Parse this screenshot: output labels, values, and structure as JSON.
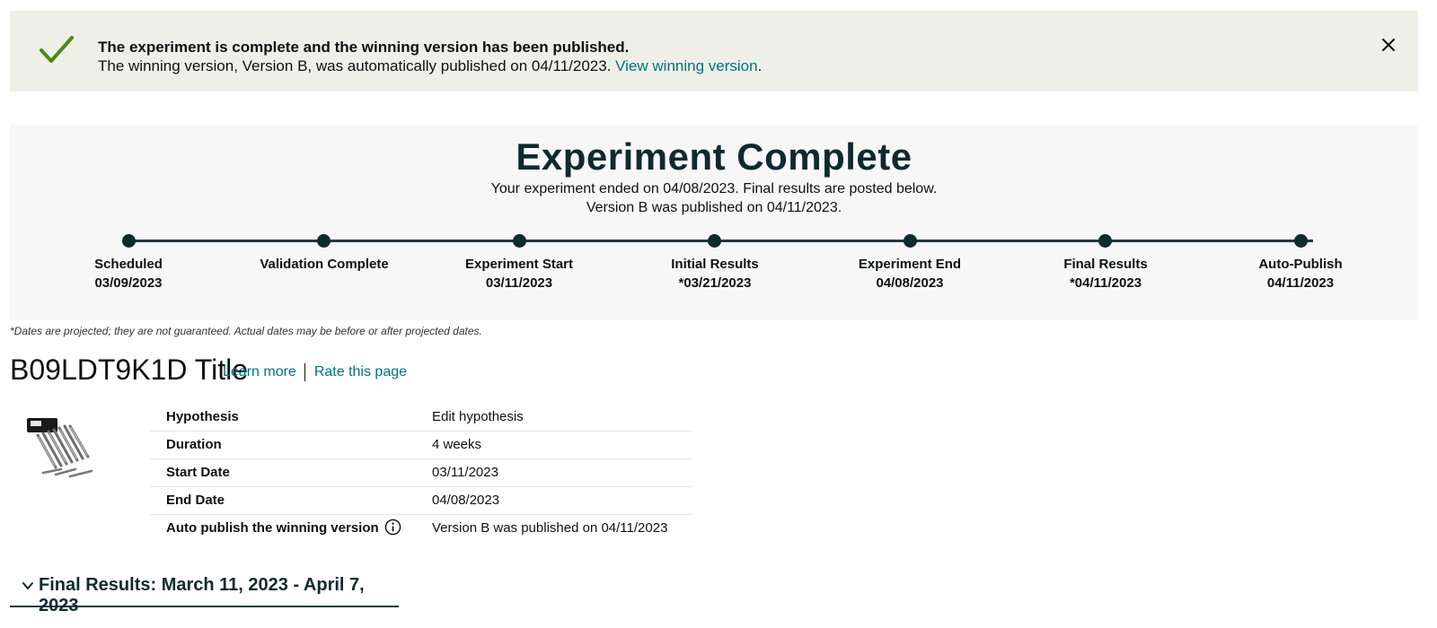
{
  "alert": {
    "title": "The experiment is complete and the winning version has been published.",
    "body": "The winning version, Version B, was automatically published on 04/11/2023. ",
    "link": "View winning version",
    "trail": ".",
    "icon": "checkmark-icon",
    "close_icon": "close-icon",
    "accent": "#4a8a1a"
  },
  "status": {
    "title": "Experiment Complete",
    "line1": "Your experiment ended on 04/08/2023. Final results are posted below.",
    "line2": "Version B was published on 04/11/2023."
  },
  "timeline": [
    {
      "label": "Scheduled",
      "date": "03/09/2023"
    },
    {
      "label": "Validation Complete",
      "date": ""
    },
    {
      "label": "Experiment Start",
      "date": "03/11/2023"
    },
    {
      "label": "Initial Results",
      "date": "*03/21/2023"
    },
    {
      "label": "Experiment End",
      "date": "04/08/2023"
    },
    {
      "label": "Final Results",
      "date": "*04/11/2023"
    },
    {
      "label": "Auto-Publish",
      "date": "04/11/2023"
    }
  ],
  "note": "*Dates are projected; they are not guaranteed. Actual dates may be before or after projected dates.",
  "header": {
    "asin_title": "B09LDT9K1D Title",
    "learn_more": "Learn more",
    "rate_page": "Rate this page"
  },
  "details": [
    {
      "label": "Hypothesis",
      "value": "Edit hypothesis",
      "is_link": true
    },
    {
      "label": "Duration",
      "value": "4 weeks"
    },
    {
      "label": "Start Date",
      "value": "03/11/2023"
    },
    {
      "label": "End Date",
      "value": "04/08/2023"
    },
    {
      "label": "Auto publish the winning version",
      "value": "Version B was published on 04/11/2023",
      "icon": "info-icon"
    }
  ],
  "results": {
    "title": "Final Results: March 11, 2023 - April 7, 2023",
    "icon": "chevron-down-icon"
  },
  "colors": {
    "alert_bg": "#eef0e7",
    "panel_bg": "#f7f7f7",
    "link": "#007185",
    "timeline": "#102a2e"
  }
}
